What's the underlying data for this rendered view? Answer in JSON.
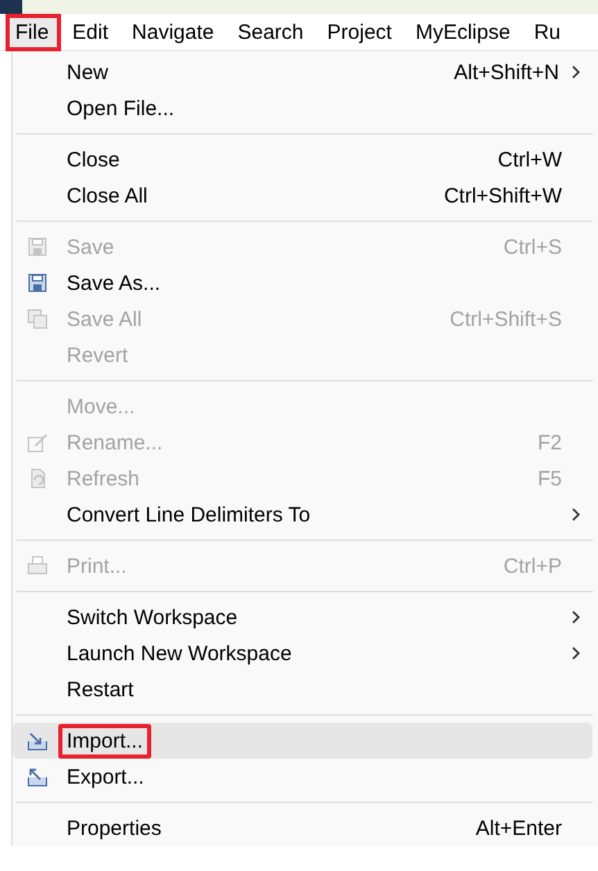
{
  "menu_bar": [
    {
      "label": "File",
      "annotated": true,
      "selected": true
    },
    {
      "label": "Edit",
      "annotated": false,
      "selected": false
    },
    {
      "label": "Navigate",
      "annotated": false,
      "selected": false
    },
    {
      "label": "Search",
      "annotated": false,
      "selected": false
    },
    {
      "label": "Project",
      "annotated": false,
      "selected": false
    },
    {
      "label": "MyEclipse",
      "annotated": false,
      "selected": false
    },
    {
      "label": "Ru",
      "annotated": false,
      "selected": false
    }
  ],
  "menu": {
    "groups": [
      [
        {
          "label": "New",
          "shortcut": "Alt+Shift+N",
          "submenu": true,
          "disabled": false,
          "selected": false,
          "annotated": false
        },
        {
          "label": "Open File...",
          "submenu": false,
          "disabled": false,
          "selected": false,
          "annotated": false
        }
      ],
      [
        {
          "label": "Close",
          "shortcut": "Ctrl+W",
          "submenu": false,
          "disabled": false,
          "selected": false,
          "annotated": false
        },
        {
          "label": "Close All",
          "shortcut": "Ctrl+Shift+W",
          "submenu": false,
          "disabled": false,
          "selected": false,
          "annotated": false
        }
      ],
      [
        {
          "label": "Save",
          "shortcut": "Ctrl+S",
          "kind": "save",
          "submenu": false,
          "disabled": true,
          "selected": false,
          "annotated": false
        },
        {
          "label": "Save As...",
          "kind": "save-as",
          "submenu": false,
          "disabled": false,
          "selected": false,
          "annotated": false
        },
        {
          "label": "Save All",
          "shortcut": "Ctrl+Shift+S",
          "kind": "save-all",
          "submenu": false,
          "disabled": true,
          "selected": false,
          "annotated": false
        },
        {
          "label": "Revert",
          "submenu": false,
          "disabled": true,
          "selected": false,
          "annotated": false
        }
      ],
      [
        {
          "label": "Move...",
          "submenu": false,
          "disabled": true,
          "selected": false,
          "annotated": false
        },
        {
          "label": "Rename...",
          "shortcut": "F2",
          "kind": "rename",
          "submenu": false,
          "disabled": true,
          "selected": false,
          "annotated": false
        },
        {
          "label": "Refresh",
          "shortcut": "F5",
          "kind": "refresh",
          "submenu": false,
          "disabled": true,
          "selected": false,
          "annotated": false
        },
        {
          "label": "Convert Line Delimiters To",
          "submenu": true,
          "disabled": false,
          "selected": false,
          "annotated": false
        }
      ],
      [
        {
          "label": "Print...",
          "shortcut": "Ctrl+P",
          "kind": "print",
          "submenu": false,
          "disabled": true,
          "selected": false,
          "annotated": false
        }
      ],
      [
        {
          "label": "Switch Workspace",
          "submenu": true,
          "disabled": false,
          "selected": false,
          "annotated": false
        },
        {
          "label": "Launch New Workspace",
          "submenu": true,
          "disabled": false,
          "selected": false,
          "annotated": false
        },
        {
          "label": "Restart",
          "submenu": false,
          "disabled": false,
          "selected": false,
          "annotated": false
        }
      ],
      [
        {
          "label": "Import...",
          "kind": "import",
          "submenu": false,
          "disabled": false,
          "selected": true,
          "annotated": true
        },
        {
          "label": "Export...",
          "kind": "export",
          "submenu": false,
          "disabled": false,
          "selected": false,
          "annotated": false
        }
      ],
      [
        {
          "label": "Properties",
          "shortcut": "Alt+Enter",
          "submenu": false,
          "disabled": false,
          "selected": false,
          "annotated": false
        }
      ]
    ]
  }
}
